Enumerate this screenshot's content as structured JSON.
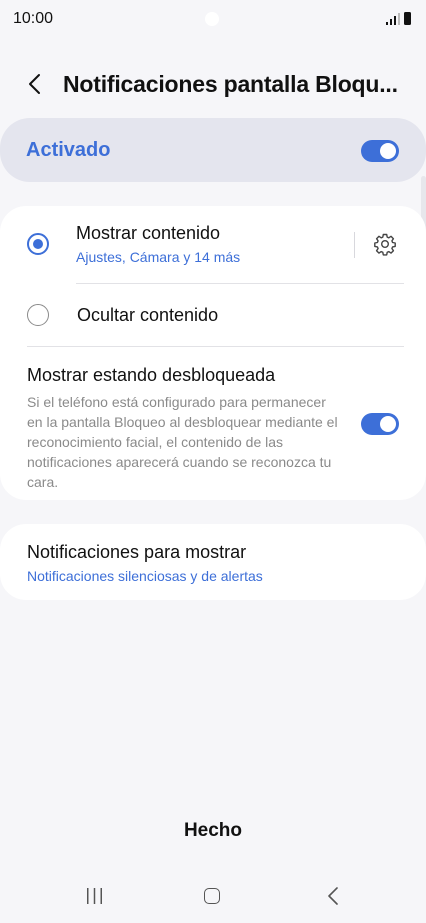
{
  "status_bar": {
    "time": "10:00"
  },
  "header": {
    "title": "Notificaciones pantalla Bloqu..."
  },
  "master": {
    "label": "Activado",
    "enabled": true
  },
  "options": [
    {
      "title": "Mostrar contenido",
      "subtitle": "Ajustes, Cámara y 14 más",
      "selected": true
    },
    {
      "title": "Ocultar contenido",
      "selected": false
    }
  ],
  "show_unlocked": {
    "title": "Mostrar estando desbloqueada",
    "description": "Si el teléfono está configurado para permanecer en la pantalla Bloqueo al desbloquear mediante el reconocimiento facial, el contenido de las notificaciones aparecerá cuando se reconozca tu cara.",
    "enabled": true
  },
  "notifications_to_show": {
    "title": "Notificaciones para mostrar",
    "value": "Notificaciones silenciosas y de alertas"
  },
  "footer": {
    "done_label": "Hecho"
  },
  "colors": {
    "accent": "#3d6fd8",
    "background": "#f6f6f9",
    "card": "#ffffff",
    "master_card": "#e4e5ee"
  },
  "icons": [
    "back-icon",
    "gear-icon",
    "signal-icon",
    "battery-icon",
    "recents-icon",
    "home-icon",
    "nav-back-icon"
  ]
}
